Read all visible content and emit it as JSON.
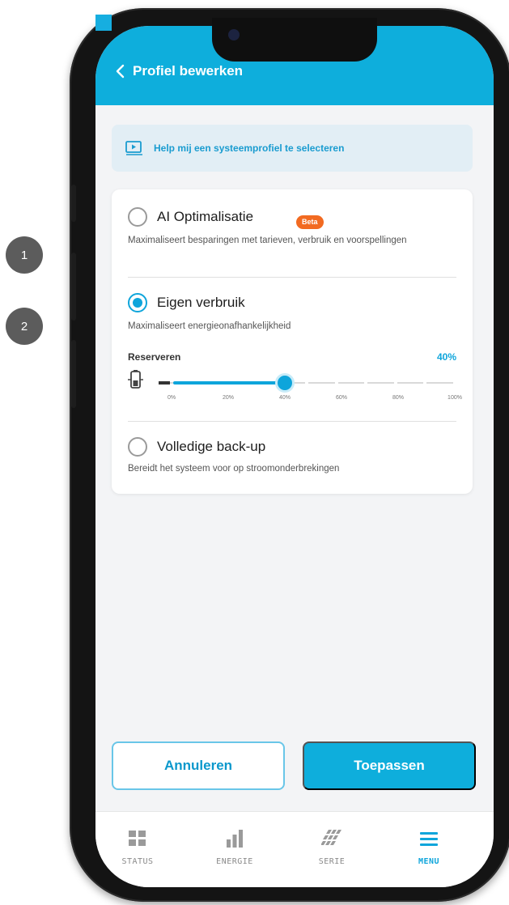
{
  "annotations": [
    "1",
    "2"
  ],
  "header": {
    "title": "Profiel bewerken",
    "back_icon": "chevron-left-icon"
  },
  "help": {
    "text": "Help mij een systeemprofiel te selecteren",
    "icon": "video-tutorial-icon"
  },
  "options": [
    {
      "title": "AI Optimalisatie",
      "badge": "Beta",
      "description": "Maximaliseert besparingen met tarieven, verbruik en voorspellingen",
      "selected": false
    },
    {
      "title": "Eigen verbruik",
      "description": "Maximaliseert energieonafhankelijkheid",
      "selected": true
    },
    {
      "title": "Volledige back-up",
      "description": "Bereidt het systeem voor op stroomonderbrekingen",
      "selected": false
    }
  ],
  "reserve": {
    "label": "Reserveren",
    "value_text": "40%",
    "value": 40,
    "ticks": [
      "0%",
      "20%",
      "40%",
      "60%",
      "80%",
      "100%"
    ],
    "icon": "battery-icon"
  },
  "buttons": {
    "cancel": "Annuleren",
    "apply": "Toepassen"
  },
  "nav": [
    {
      "label": "STATUS",
      "icon": "grid-icon",
      "active": false
    },
    {
      "label": "ENERGIE",
      "icon": "bar-chart-icon",
      "active": false
    },
    {
      "label": "SERIE",
      "icon": "solar-panel-icon",
      "active": false
    },
    {
      "label": "MENU",
      "icon": "hamburger-menu-icon",
      "active": true
    }
  ],
  "colors": {
    "accent": "#0eaedc",
    "badge": "#f26a21"
  }
}
